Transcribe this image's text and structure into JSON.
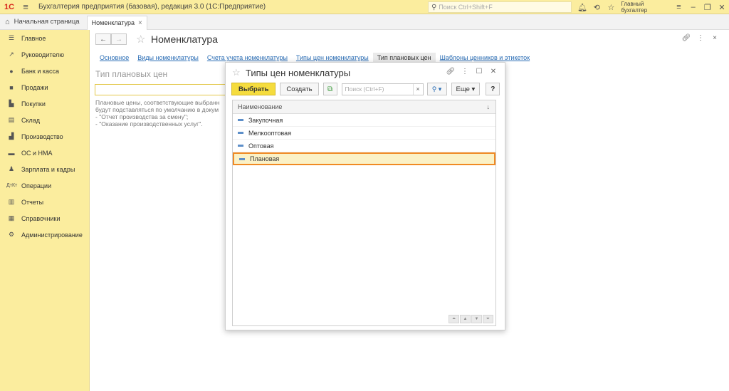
{
  "app": {
    "logo": "1С",
    "title": "Бухгалтерия предприятия (базовая), редакция 3.0  (1С:Предприятие)",
    "search_placeholder": "Поиск Ctrl+Shift+F",
    "user": "Главный бухгалтер"
  },
  "tabs": {
    "home": "Начальная страница",
    "open": "Номенклатура"
  },
  "sidebar": {
    "items": [
      {
        "label": "Главное",
        "icon": "menu-icon"
      },
      {
        "label": "Руководителю",
        "icon": "trend-icon"
      },
      {
        "label": "Банк и касса",
        "icon": "coin-icon"
      },
      {
        "label": "Продажи",
        "icon": "bag-icon"
      },
      {
        "label": "Покупки",
        "icon": "cart-icon"
      },
      {
        "label": "Склад",
        "icon": "warehouse-icon"
      },
      {
        "label": "Производство",
        "icon": "factory-icon"
      },
      {
        "label": "ОС и НМА",
        "icon": "truck-icon"
      },
      {
        "label": "Зарплата и кадры",
        "icon": "person-icon"
      },
      {
        "label": "Операции",
        "icon": "dt-kt-icon"
      },
      {
        "label": "Отчеты",
        "icon": "bar-chart-icon"
      },
      {
        "label": "Справочники",
        "icon": "book-icon"
      },
      {
        "label": "Администрирование",
        "icon": "gear-icon"
      }
    ]
  },
  "main": {
    "title": "Номенклатура",
    "subtabs": [
      "Основное",
      "Виды номенклатуры",
      "Счета учета номенклатуры",
      "Типы цен номенклатуры",
      "Тип плановых цен",
      "Шаблоны ценников и этикеток"
    ],
    "active_subtab": 4,
    "section_title": "Тип плановых цен",
    "hint_line1": "Плановые цены, соответствующие выбранн",
    "hint_line2": "будут подставляться по умолчанию в докум",
    "hint_line3": "- \"Отчет производства за смену\";",
    "hint_line4": "- \"Оказание производственных услуг\"."
  },
  "dialog": {
    "title": "Типы цен номенклатуры",
    "select_label": "Выбрать",
    "create_label": "Создать",
    "search_placeholder": "Поиск (Ctrl+F)",
    "more_label": "Еще",
    "help_label": "?",
    "column_header": "Наименование",
    "rows": [
      "Закупочная",
      "Мелкооптовая",
      "Оптовая",
      "Плановая"
    ],
    "selected_index": 3
  },
  "colors": {
    "accent_yellow": "#fbed9e",
    "primary_button": "#f5dc3e",
    "selection_border": "#f08a24",
    "link": "#2a6db5"
  }
}
